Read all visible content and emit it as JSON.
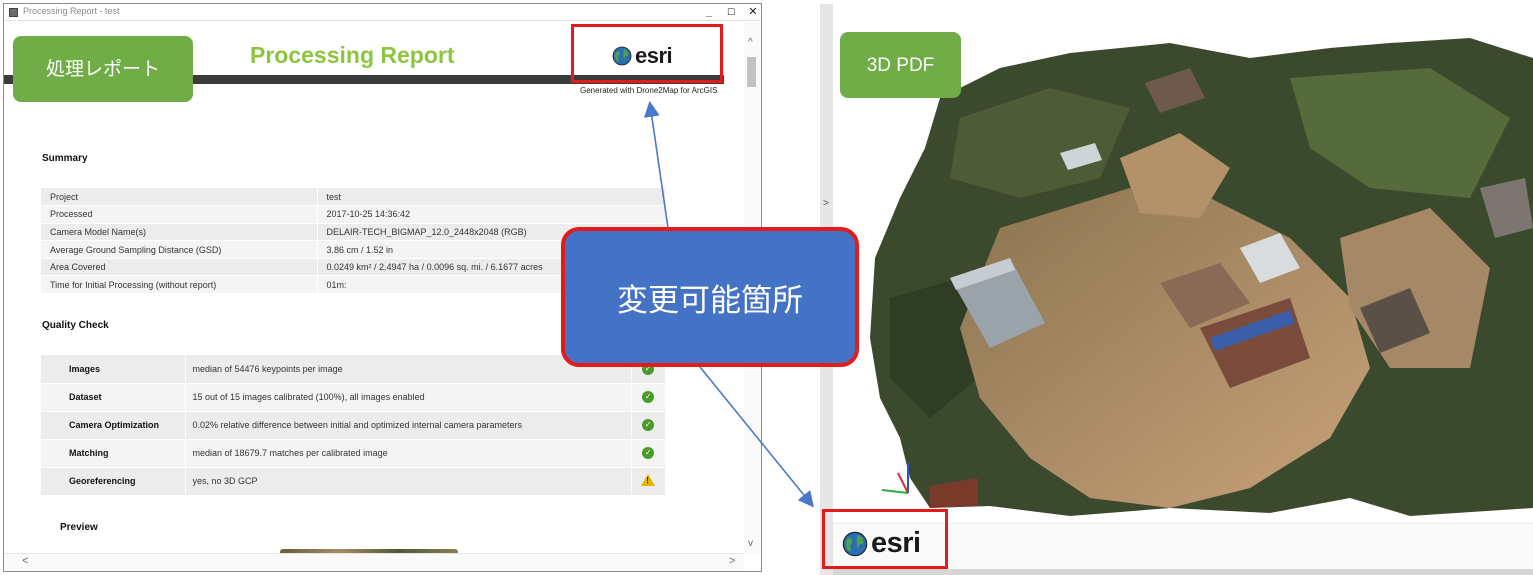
{
  "window": {
    "title": "Processing Report - test",
    "minimize": "_",
    "maximize": "☐",
    "close": "✕"
  },
  "report": {
    "title": "Processing Report",
    "brand": "esri",
    "generated_with": "Generated with Drone2Map for ArcGIS",
    "summary_heading": "Summary",
    "summary_rows": [
      {
        "key": "Project",
        "value": "test"
      },
      {
        "key": "Processed",
        "value": "2017-10-25 14:36:42"
      },
      {
        "key": "Camera Model Name(s)",
        "value": "DELAIR-TECH_BIGMAP_12.0_2448x2048 (RGB)"
      },
      {
        "key": "Average Ground Sampling Distance (GSD)",
        "value": "3.86 cm / 1.52 in"
      },
      {
        "key": "Area Covered",
        "value": "0.0249 km² / 2.4947 ha / 0.0096 sq. mi. / 6.1677 acres"
      },
      {
        "key": "Time for Initial Processing (without report)",
        "value": "01m:"
      }
    ],
    "quality_heading": "Quality Check",
    "quality_rows": [
      {
        "name": "Images",
        "value": "median of 54476 keypoints per image",
        "status": "ok"
      },
      {
        "name": "Dataset",
        "value": "15 out of 15 images calibrated (100%), all images enabled",
        "status": "ok"
      },
      {
        "name": "Camera Optimization",
        "value": "0.02% relative difference between initial and optimized internal camera parameters",
        "status": "ok"
      },
      {
        "name": "Matching",
        "value": "median of 18679.7 matches per calibrated image",
        "status": "ok"
      },
      {
        "name": "Georeferencing",
        "value": "yes, no 3D GCP",
        "status": "warning"
      }
    ],
    "preview_heading": "Preview"
  },
  "scrollbar": {
    "up": "^",
    "down": "v",
    "left": "<",
    "right": ">"
  },
  "pdf_viewer": {
    "sidebar_toggle": ">",
    "brand": "esri"
  },
  "labels": {
    "report_tag": "処理レポート",
    "pdf_tag": "3D PDF",
    "callout": "変更可能箇所"
  },
  "colors": {
    "tag_green": "#70ad47",
    "callout_blue": "#4472c4",
    "highlight_red": "#e51b1b",
    "report_title_green": "#8cc63f",
    "arrow_blue": "#4a78c8"
  },
  "icons": {
    "status_ok": "check-circle-icon",
    "status_warning": "warning-triangle-icon",
    "esri_globe": "globe-icon"
  }
}
